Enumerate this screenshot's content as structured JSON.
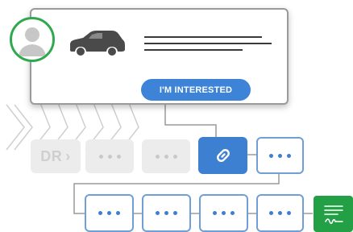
{
  "card": {
    "cta_label": "I'M INTERESTED"
  },
  "flow": {
    "first_step_text": "DR",
    "first_step_arrow": "›"
  },
  "colors": {
    "accent_blue": "#3d84d9",
    "active_step": "#3d7fd0",
    "avatar_ring": "#2fa84f",
    "sign_green": "#23a046",
    "connector": "#9a9a9a",
    "faded_step": "#ececec"
  }
}
